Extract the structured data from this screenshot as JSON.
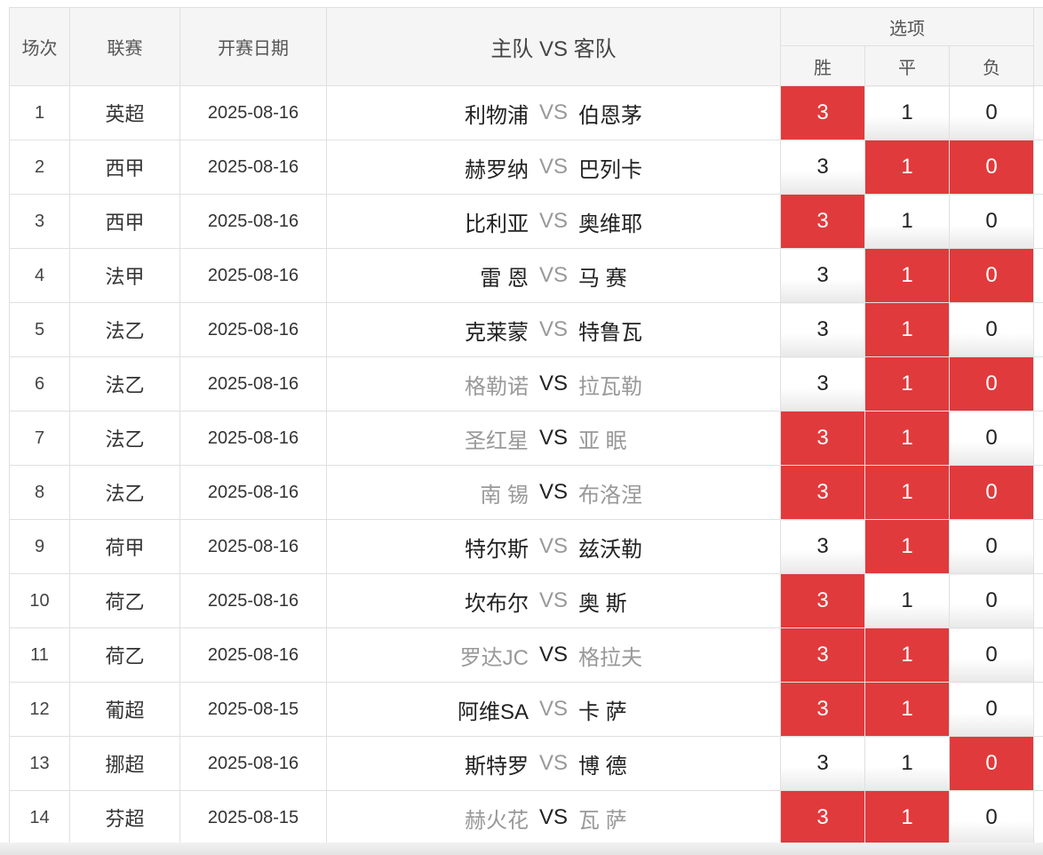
{
  "header": {
    "index": "场次",
    "league": "联赛",
    "date": "开赛日期",
    "match": "主队 VS 客队",
    "options": "选项",
    "win": "胜",
    "draw": "平",
    "lose": "负"
  },
  "rows": [
    {
      "index": "1",
      "league": "英超",
      "date": "2025-08-16",
      "home": "利物浦",
      "home_color": "dark",
      "vs": "VS",
      "vs_color": "grey",
      "away": "伯恩茅",
      "away_color": "dark",
      "win": "3",
      "draw": "1",
      "lose": "0",
      "win_on": true,
      "draw_on": false,
      "lose_on": false
    },
    {
      "index": "2",
      "league": "西甲",
      "date": "2025-08-16",
      "home": "赫罗纳",
      "home_color": "dark",
      "vs": "VS",
      "vs_color": "grey",
      "away": "巴列卡",
      "away_color": "dark",
      "win": "3",
      "draw": "1",
      "lose": "0",
      "win_on": false,
      "draw_on": true,
      "lose_on": true
    },
    {
      "index": "3",
      "league": "西甲",
      "date": "2025-08-16",
      "home": "比利亚",
      "home_color": "dark",
      "vs": "VS",
      "vs_color": "grey",
      "away": "奥维耶",
      "away_color": "dark",
      "win": "3",
      "draw": "1",
      "lose": "0",
      "win_on": true,
      "draw_on": false,
      "lose_on": false
    },
    {
      "index": "4",
      "league": "法甲",
      "date": "2025-08-16",
      "home": "雷 恩",
      "home_color": "dark",
      "vs": "VS",
      "vs_color": "grey",
      "away": "马 赛",
      "away_color": "dark",
      "win": "3",
      "draw": "1",
      "lose": "0",
      "win_on": false,
      "draw_on": true,
      "lose_on": true
    },
    {
      "index": "5",
      "league": "法乙",
      "date": "2025-08-16",
      "home": "克莱蒙",
      "home_color": "dark",
      "vs": "VS",
      "vs_color": "grey",
      "away": "特鲁瓦",
      "away_color": "dark",
      "win": "3",
      "draw": "1",
      "lose": "0",
      "win_on": false,
      "draw_on": true,
      "lose_on": false
    },
    {
      "index": "6",
      "league": "法乙",
      "date": "2025-08-16",
      "home": "格勒诺",
      "home_color": "grey",
      "vs": "VS",
      "vs_color": "dark",
      "away": "拉瓦勒",
      "away_color": "grey",
      "win": "3",
      "draw": "1",
      "lose": "0",
      "win_on": false,
      "draw_on": true,
      "lose_on": true
    },
    {
      "index": "7",
      "league": "法乙",
      "date": "2025-08-16",
      "home": "圣红星",
      "home_color": "grey",
      "vs": "VS",
      "vs_color": "dark",
      "away": "亚 眠",
      "away_color": "grey",
      "win": "3",
      "draw": "1",
      "lose": "0",
      "win_on": true,
      "draw_on": true,
      "lose_on": false
    },
    {
      "index": "8",
      "league": "法乙",
      "date": "2025-08-16",
      "home": "南 锡",
      "home_color": "grey",
      "vs": "VS",
      "vs_color": "dark",
      "away": "布洛涅",
      "away_color": "grey",
      "win": "3",
      "draw": "1",
      "lose": "0",
      "win_on": true,
      "draw_on": true,
      "lose_on": true
    },
    {
      "index": "9",
      "league": "荷甲",
      "date": "2025-08-16",
      "home": "特尔斯",
      "home_color": "dark",
      "vs": "VS",
      "vs_color": "grey",
      "away": "兹沃勒",
      "away_color": "dark",
      "win": "3",
      "draw": "1",
      "lose": "0",
      "win_on": false,
      "draw_on": true,
      "lose_on": false
    },
    {
      "index": "10",
      "league": "荷乙",
      "date": "2025-08-16",
      "home": "坎布尔",
      "home_color": "dark",
      "vs": "VS",
      "vs_color": "grey",
      "away": "奥 斯",
      "away_color": "dark",
      "win": "3",
      "draw": "1",
      "lose": "0",
      "win_on": true,
      "draw_on": false,
      "lose_on": false
    },
    {
      "index": "11",
      "league": "荷乙",
      "date": "2025-08-16",
      "home": "罗达JC",
      "home_color": "grey",
      "vs": "VS",
      "vs_color": "dark",
      "away": "格拉夫",
      "away_color": "grey",
      "win": "3",
      "draw": "1",
      "lose": "0",
      "win_on": true,
      "draw_on": true,
      "lose_on": false
    },
    {
      "index": "12",
      "league": "葡超",
      "date": "2025-08-15",
      "home": "阿维SA",
      "home_color": "dark",
      "vs": "VS",
      "vs_color": "grey",
      "away": "卡 萨",
      "away_color": "dark",
      "win": "3",
      "draw": "1",
      "lose": "0",
      "win_on": true,
      "draw_on": true,
      "lose_on": false
    },
    {
      "index": "13",
      "league": "挪超",
      "date": "2025-08-16",
      "home": "斯特罗",
      "home_color": "dark",
      "vs": "VS",
      "vs_color": "grey",
      "away": "博 德",
      "away_color": "dark",
      "win": "3",
      "draw": "1",
      "lose": "0",
      "win_on": false,
      "draw_on": false,
      "lose_on": true
    },
    {
      "index": "14",
      "league": "芬超",
      "date": "2025-08-15",
      "home": "赫火花",
      "home_color": "grey",
      "vs": "VS",
      "vs_color": "dark",
      "away": "瓦 萨",
      "away_color": "grey",
      "win": "3",
      "draw": "1",
      "lose": "0",
      "win_on": true,
      "draw_on": true,
      "lose_on": false
    }
  ],
  "colors": {
    "selected": "#e03a3c",
    "header_bg": "#f5f5f5",
    "border": "#e0e0e0"
  }
}
